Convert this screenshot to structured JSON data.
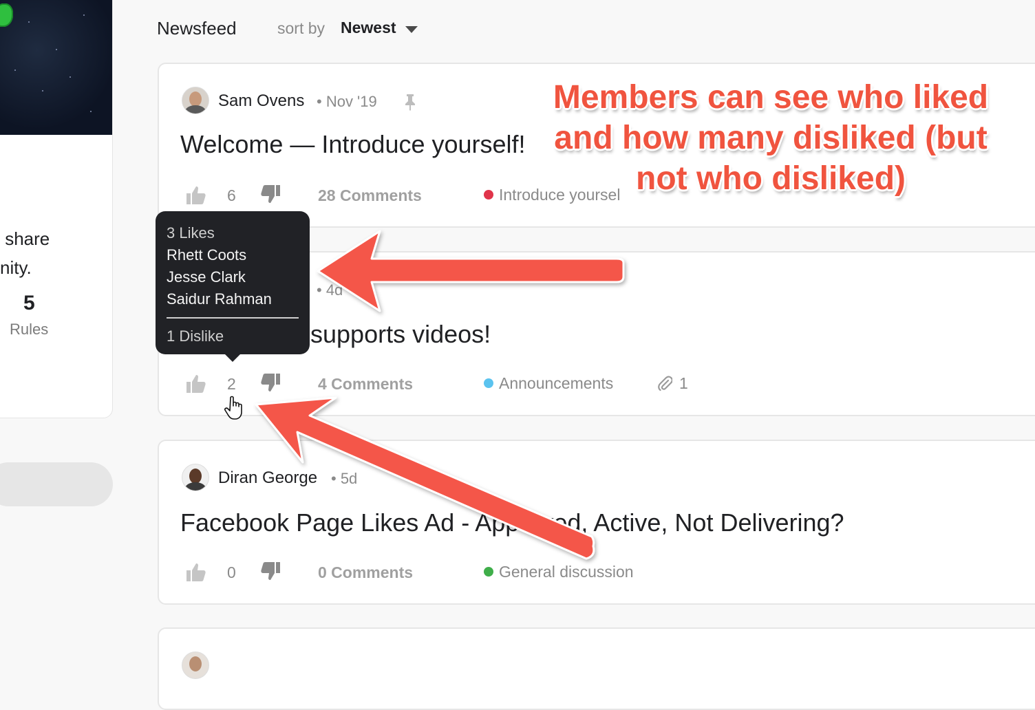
{
  "sidebar": {
    "description_lines": " share\nnity.",
    "rules_count": "5",
    "rules_label": "Rules"
  },
  "header": {
    "title": "Newsfeed",
    "sort_label": "sort by",
    "sort_value": "Newest"
  },
  "posts": [
    {
      "author": "Sam Ovens",
      "meta": "• Nov '19",
      "title": "Welcome — Introduce yourself!",
      "likes": "6",
      "comments": "28 Comments",
      "category": "Introduce yoursel",
      "category_color": "#e0344a"
    },
    {
      "author": "",
      "meta": "• 4d",
      "title": "supports videos!",
      "likes": "2",
      "comments": "4 Comments",
      "category": "Announcements",
      "category_color": "#5bc3ef",
      "attachments": "1"
    },
    {
      "author": "Diran George",
      "meta": "• 5d",
      "title": "Facebook Page Likes Ad - Approved, Active, Not Delivering?",
      "likes": "0",
      "comments": "0 Comments",
      "category": "General discussion",
      "category_color": "#3fae4a"
    }
  ],
  "tooltip": {
    "likes_header": "3 Likes",
    "likers": [
      "Rhett Coots",
      "Jesse Clark",
      "Saidur Rahman"
    ],
    "dislikes": "1 Dislike"
  },
  "annotation": {
    "text": "Members can see who liked and how many disliked (but not who disliked)",
    "color": "#f0543f"
  },
  "icons": [
    "thumbs-up-icon",
    "thumbs-down-icon",
    "pin-icon",
    "paperclip-icon",
    "chevron-down-icon",
    "hand-cursor-icon"
  ]
}
